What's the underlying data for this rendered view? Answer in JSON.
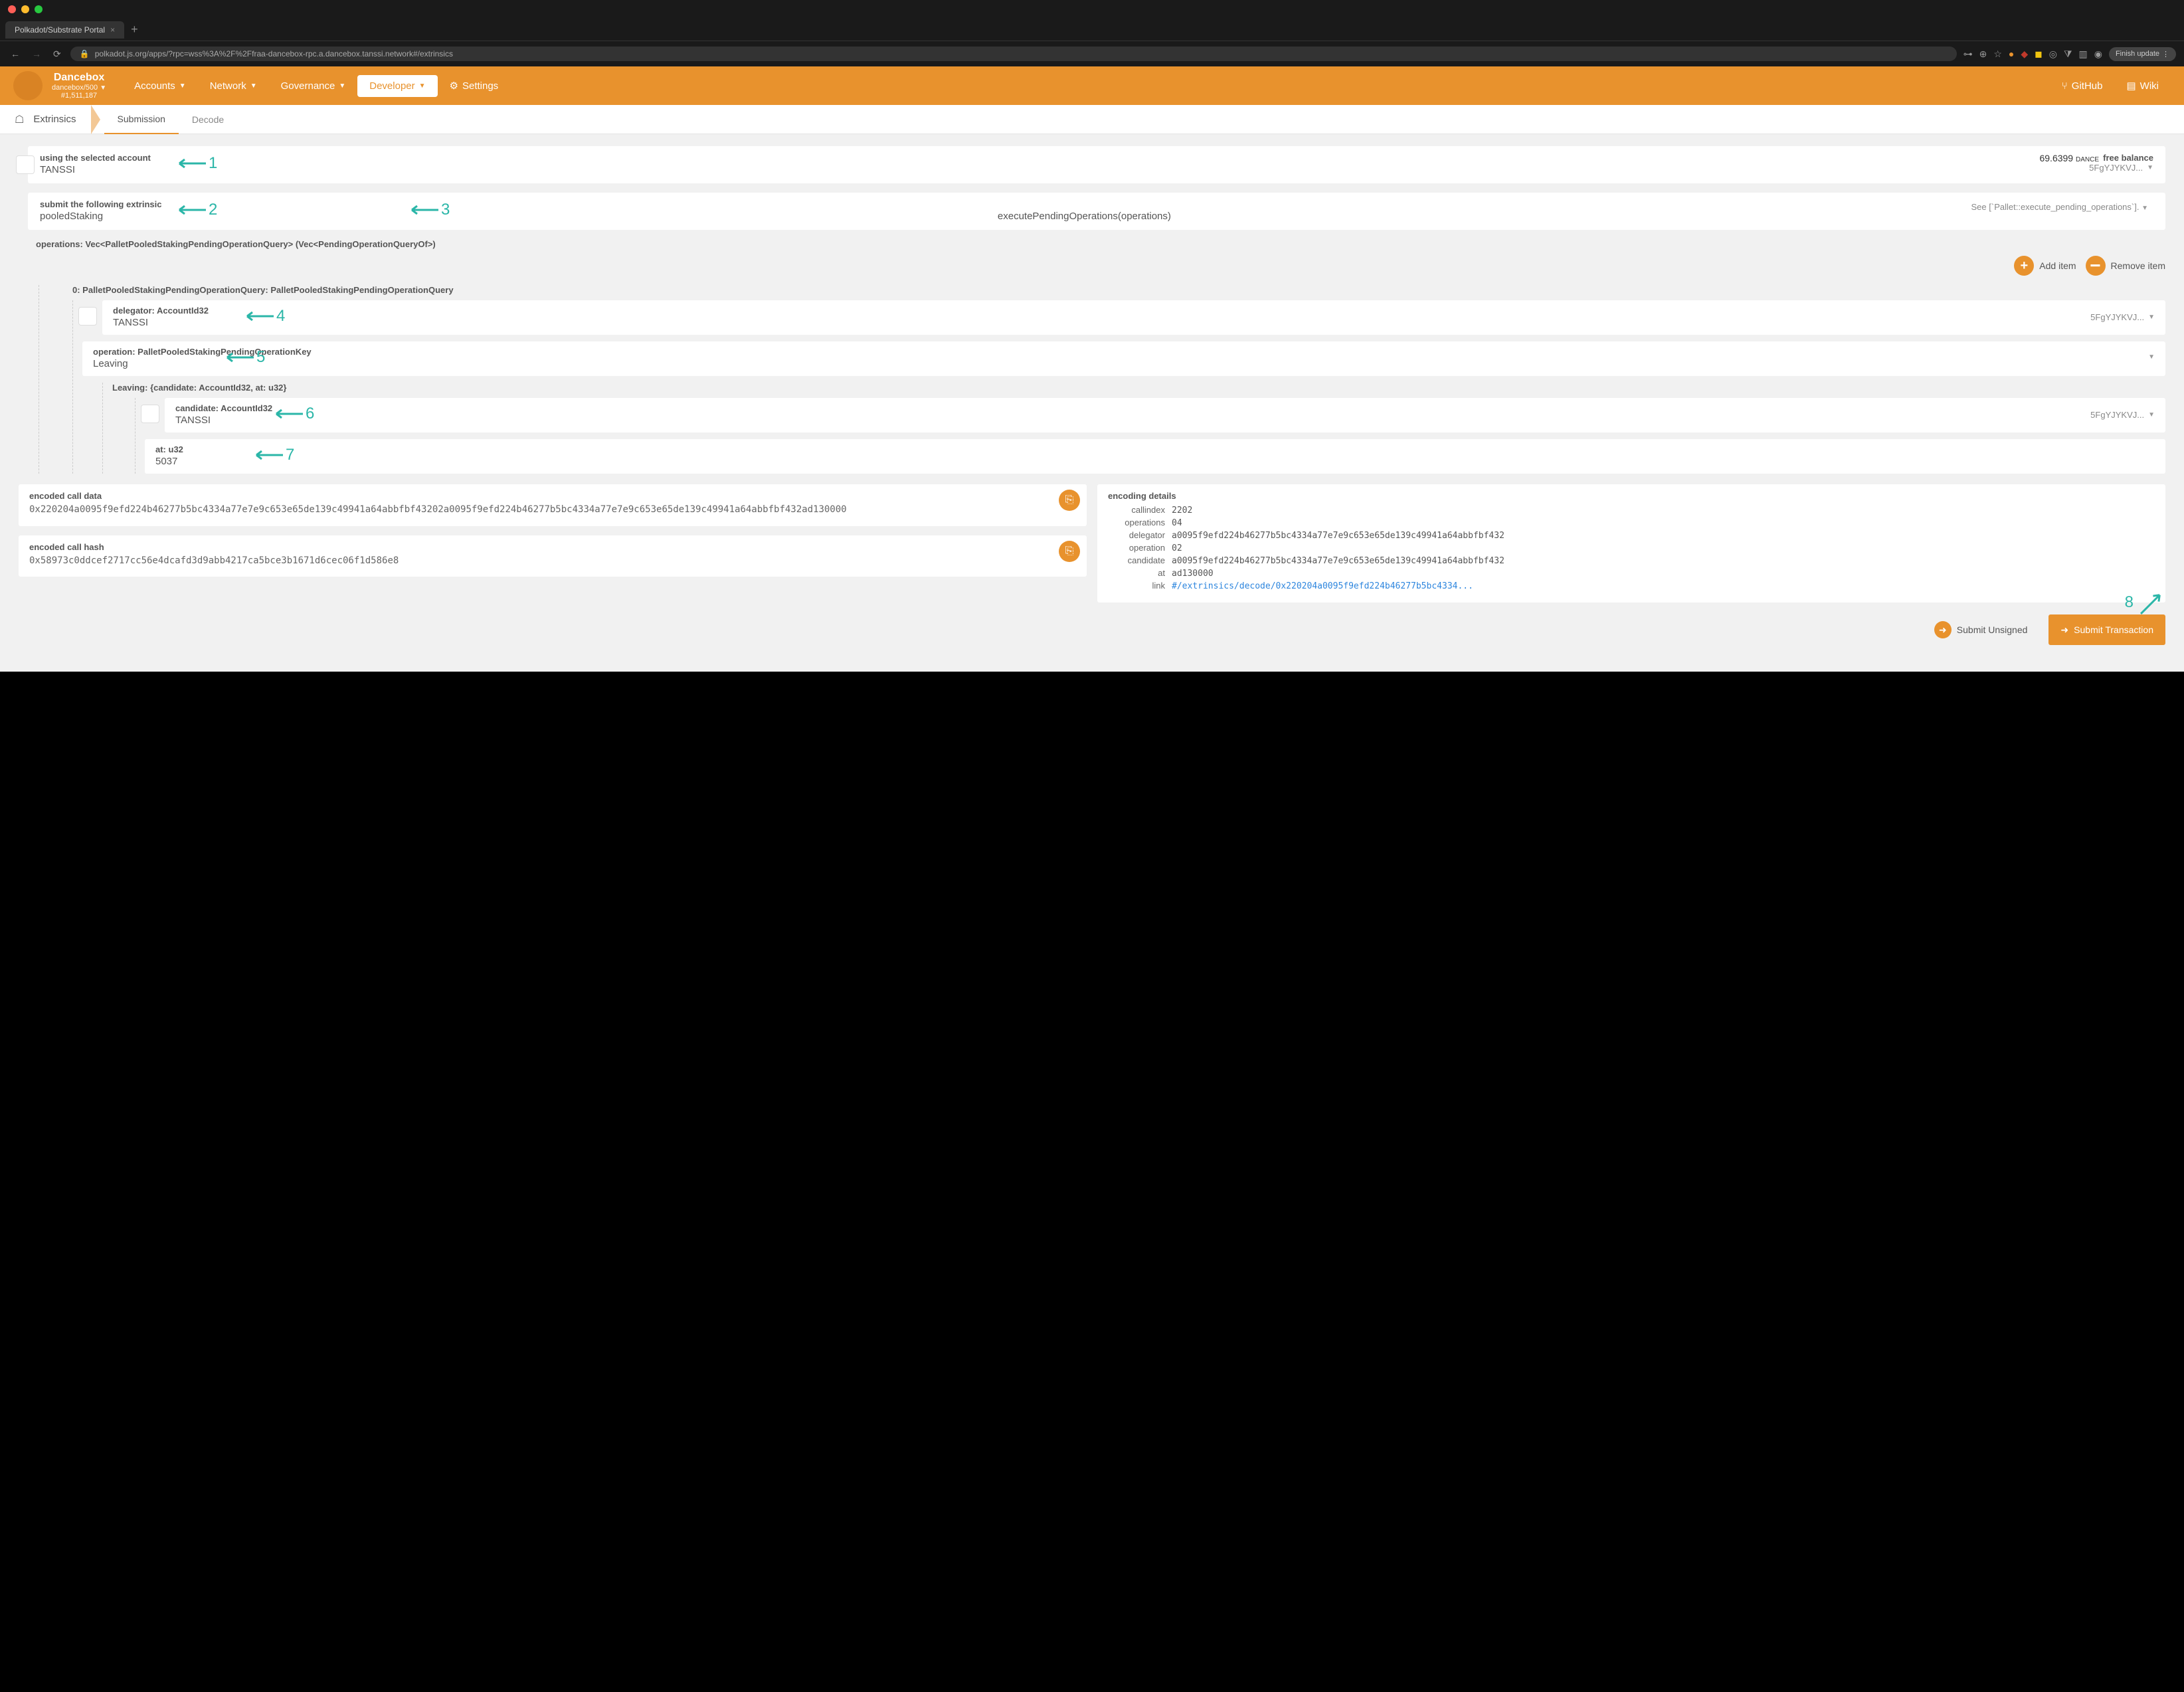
{
  "browser": {
    "tab_title": "Polkadot/Substrate Portal",
    "url_text": "polkadot.js.org/apps/?rpc=wss%3A%2F%2Ffraa-dancebox-rpc.a.dancebox.tanssi.network#/extrinsics",
    "finish_update": "Finish update"
  },
  "topnav": {
    "chain_name": "Dancebox",
    "chain_sub": "dancebox/500",
    "block": "#1,511,187",
    "items": {
      "accounts": "Accounts",
      "network": "Network",
      "governance": "Governance",
      "developer": "Developer",
      "settings": "Settings",
      "github": "GitHub",
      "wiki": "Wiki"
    }
  },
  "subnav": {
    "title": "Extrinsics",
    "tabs": {
      "submission": "Submission",
      "decode": "Decode"
    }
  },
  "account_card": {
    "label": "using the selected account",
    "value": "TANSSI",
    "balance_label": "free balance",
    "balance_value": "69.6399",
    "balance_unit": "DANCE",
    "addr_short": "5FgYJYKVJ..."
  },
  "extrinsic_card": {
    "label": "submit the following extrinsic",
    "pallet": "pooledStaking",
    "call": "executePendingOperations(operations)",
    "see": "See [`Pallet::execute_pending_operations`]."
  },
  "params": {
    "title": "operations: Vec<PalletPooledStakingPendingOperationQuery> (Vec<PendingOperationQueryOf>)",
    "add_item": "Add item",
    "remove_item": "Remove item",
    "item_header": "0: PalletPooledStakingPendingOperationQuery: PalletPooledStakingPendingOperationQuery",
    "delegator_label": "delegator: AccountId32",
    "delegator_value": "TANSSI",
    "delegator_addr": "5FgYJYKVJ...",
    "operation_label": "operation: PalletPooledStakingPendingOperationKey",
    "operation_value": "Leaving",
    "leaving_label": "Leaving: {candidate: AccountId32, at: u32}",
    "candidate_label": "candidate: AccountId32",
    "candidate_value": "TANSSI",
    "candidate_addr": "5FgYJYKVJ...",
    "at_label": "at: u32",
    "at_value": "5037"
  },
  "encoded": {
    "call_data_label": "encoded call data",
    "call_data": "0x220204a0095f9efd224b46277b5bc4334a77e7e9c653e65de139c49941a64abbfbf43202a0095f9efd224b46277b5bc4334a77e7e9c653e65de139c49941a64abbfbf432ad130000",
    "call_hash_label": "encoded call hash",
    "call_hash": "0x58973c0ddcef2717cc56e4dcafd3d9abb4217ca5bce3b1671d6cec06f1d586e8"
  },
  "details": {
    "title": "encoding details",
    "callindex_k": "callindex",
    "callindex_v": "2202",
    "operations_k": "operations",
    "operations_v": "04",
    "delegator_k": "delegator",
    "delegator_v": "a0095f9efd224b46277b5bc4334a77e7e9c653e65de139c49941a64abbfbf432",
    "operation_k": "operation",
    "operation_v": "02",
    "candidate_k": "candidate",
    "candidate_v": "a0095f9efd224b46277b5bc4334a77e7e9c653e65de139c49941a64abbfbf432",
    "at_k": "at",
    "at_v": "ad130000",
    "link_k": "link",
    "link_v": "#/extrinsics/decode/0x220204a0095f9efd224b46277b5bc4334..."
  },
  "buttons": {
    "unsigned": "Submit Unsigned",
    "submit": "Submit Transaction"
  },
  "annotations": {
    "n1": "1",
    "n2": "2",
    "n3": "3",
    "n4": "4",
    "n5": "5",
    "n6": "6",
    "n7": "7",
    "n8": "8"
  }
}
